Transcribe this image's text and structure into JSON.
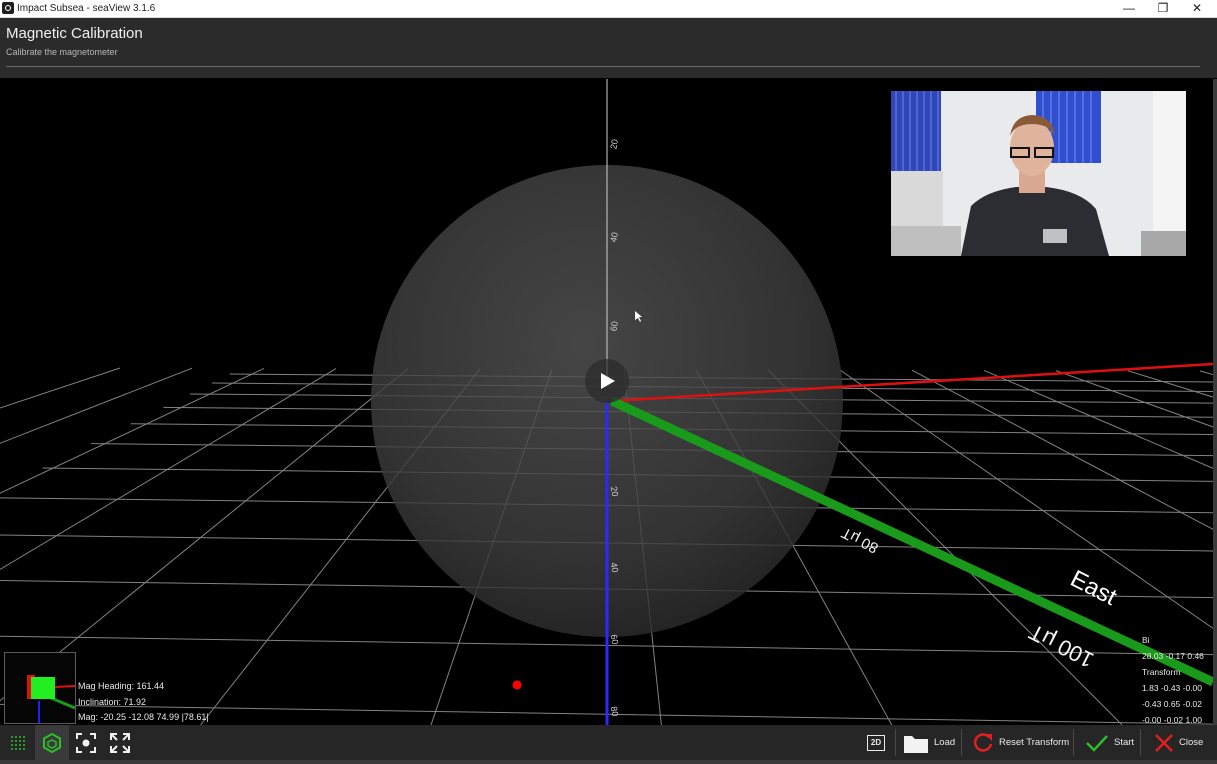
{
  "window": {
    "title": "Impact Subsea - seaView 3.1.6",
    "minimize": "—",
    "maximize": "❐",
    "close": "✕"
  },
  "header": {
    "title": "Magnetic Calibration",
    "subtitle": "Calibrate the magnetometer"
  },
  "scene": {
    "axis_labels": [
      "80 μT",
      "100 μT",
      "East"
    ],
    "axis_colors": {
      "north": "#e01010",
      "east": "#1a9a1a",
      "down": "#2020ff"
    },
    "sample_point_color": "#ff0000"
  },
  "hud_left": {
    "heading": "Mag Heading: 161.44",
    "inclination": "Inclination: 71.92",
    "mag": "Mag: -20.25 -12.08 74.99 |78.61|"
  },
  "hud_right": {
    "bias_label": "Bi",
    "bias_values": "28.03 -0.17 0.46",
    "transform_label": "Transform",
    "transform_rows": [
      "1.83 -0.43 -0.00",
      "-0.43 0.65 -0.02",
      "-0.00 -0.02 1.00"
    ]
  },
  "toolbar": {
    "left_icons": [
      "grid-icon",
      "cube-icon",
      "focus-icon",
      "expand-icon"
    ],
    "view_2d_label": "2D",
    "load_label": "Load",
    "reset_label": "Reset Transform",
    "start_label": "Start",
    "close_label": "Close"
  }
}
